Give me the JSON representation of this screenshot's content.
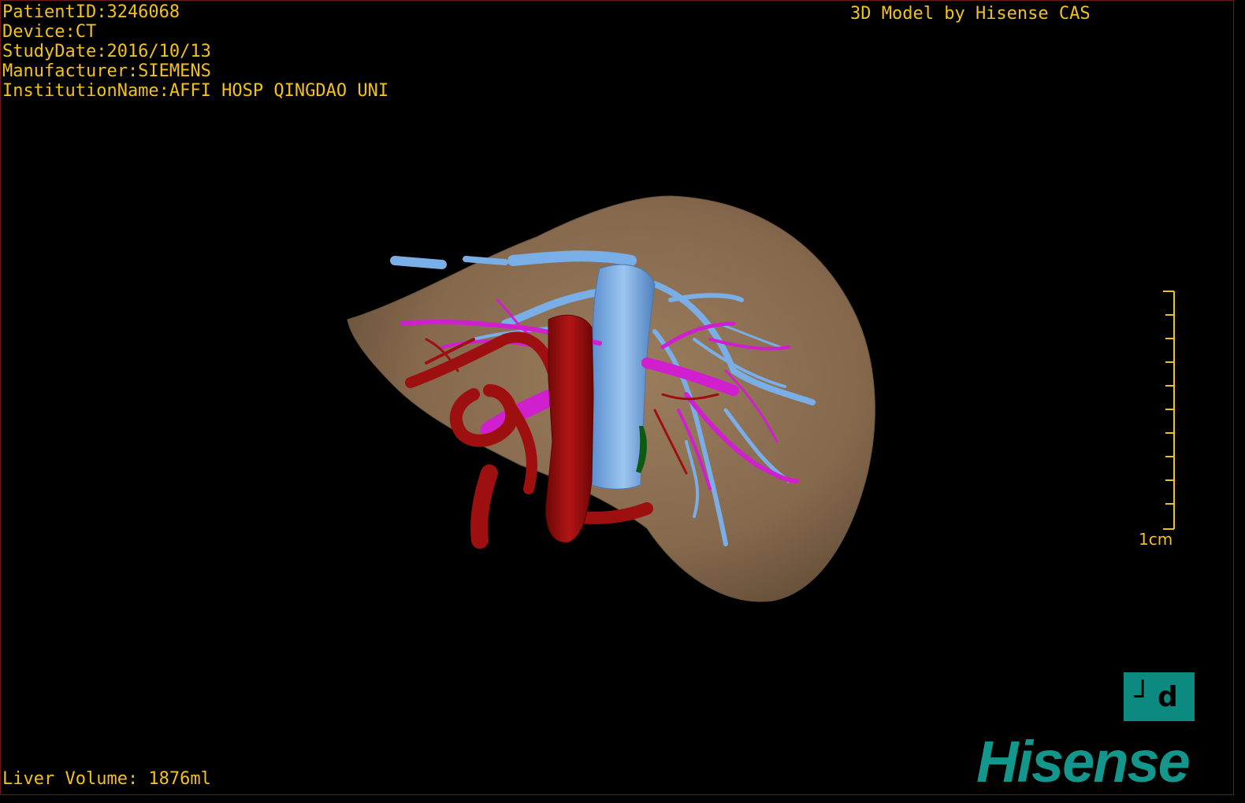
{
  "header": {
    "patient_id": "PatientID:3246068",
    "device": "Device:CT",
    "study_date": "StudyDate:2016/10/13",
    "manufacturer": "Manufacturer:SIEMENS",
    "institution": "InstitutionName:AFFI HOSP QINGDAO UNI"
  },
  "credit": "3D Model by Hisense CAS",
  "liver_volume": "Liver Volume: 1876ml",
  "scale": {
    "label": "1cm",
    "ticks": 10
  },
  "orientation_button": {
    "label": "┘d"
  },
  "brand": "Hisense",
  "colors": {
    "text": "#f2c11c",
    "liver": "#8f7356",
    "hepatic_vein": "#7aaee6",
    "portal_vein": "#d01fcf",
    "artery": "#9e0f0f",
    "brand": "#13968c"
  },
  "icons": {
    "orientation": "orientation-cube-icon",
    "scale": "scale-ruler-icon"
  }
}
